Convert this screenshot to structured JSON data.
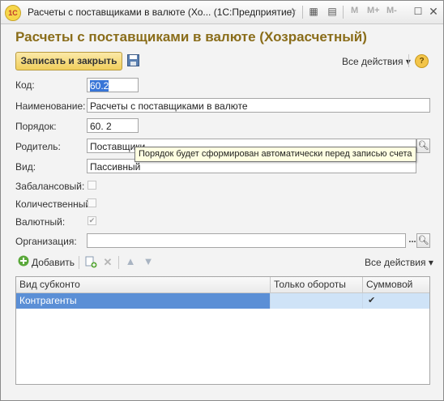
{
  "window": {
    "title": "Расчеты с поставщиками в валюте (Хо... (1С:Предприятие)",
    "logo_text": "1С",
    "memory_buttons": [
      "M",
      "M+",
      "M-"
    ]
  },
  "form": {
    "title": "Расчеты с поставщиками в валюте (Хозрасчетный)",
    "save_close_label": "Записать и закрыть",
    "all_actions_label": "Все действия",
    "help_label": "?"
  },
  "fields": {
    "code": {
      "label": "Код:",
      "value": "60.2"
    },
    "name": {
      "label": "Наименование:",
      "value": "Расчеты с поставщиками в валюте"
    },
    "order": {
      "label": "Порядок:",
      "value": "60. 2"
    },
    "parent": {
      "label": "Родитель:",
      "value": "Поставщики"
    },
    "kind": {
      "label": "Вид:",
      "value": "Пассивный"
    },
    "offbalance": {
      "label": "Забалансовый:",
      "checked": false
    },
    "quantitative": {
      "label": "Количественный:",
      "checked": false
    },
    "currency": {
      "label": "Валютный:",
      "checked": true
    },
    "organization": {
      "label": "Организация:",
      "value": ""
    }
  },
  "tooltip": "Порядок будет сформирован автоматически перед записью счета",
  "subtoolbar": {
    "add_label": "Добавить",
    "all_actions_label": "Все действия"
  },
  "table": {
    "columns": [
      "Вид субконто",
      "Только обороты",
      "Суммовой"
    ],
    "rows": [
      {
        "kind": "Контрагенты",
        "turnover_only": "",
        "sum": "✔"
      }
    ]
  },
  "colors": {
    "title_gold": "#8a6d1a",
    "button_yellow": "#f1cf5c",
    "selection_blue": "#3875d7",
    "row_highlight": "#cfe3f7"
  }
}
